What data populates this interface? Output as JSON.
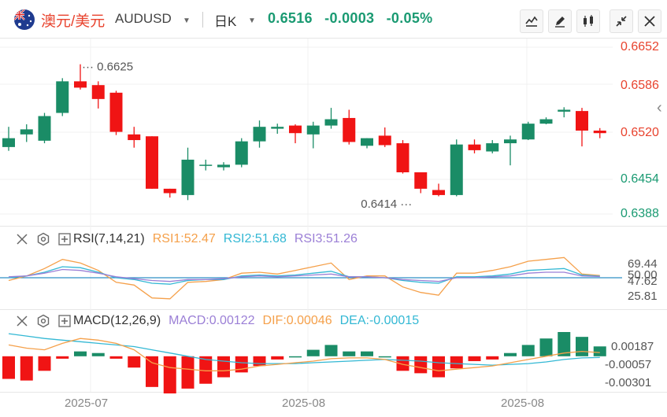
{
  "header": {
    "name": "澳元/美元",
    "code": "AUDUSD",
    "period": "日K",
    "price": "0.6516",
    "change": "-0.0003",
    "change_pct": "-0.05%"
  },
  "toolbar": {
    "icons": [
      "line-chart-icon",
      "draw-pencil-icon",
      "candle-type-icon",
      "collapse-icon",
      "close-icon"
    ]
  },
  "chart_data": [
    {
      "type": "candlestick",
      "title": "",
      "y_ticks": [
        "0.6652",
        "0.6586",
        "0.6520",
        "0.6454",
        "0.6388"
      ],
      "ylim": [
        0.6388,
        0.6652
      ],
      "x_ticks": [
        "2025-07",
        "2025-08",
        "2025-08"
      ],
      "annotations": [
        "0.6625",
        "0.6414"
      ],
      "candles": [
        {
          "o": 0.6494,
          "h": 0.6526,
          "l": 0.6488,
          "c": 0.6508
        },
        {
          "o": 0.6514,
          "h": 0.653,
          "l": 0.6502,
          "c": 0.6522
        },
        {
          "o": 0.6504,
          "h": 0.6548,
          "l": 0.65,
          "c": 0.6543
        },
        {
          "o": 0.6548,
          "h": 0.6603,
          "l": 0.6543,
          "c": 0.6598
        },
        {
          "o": 0.6598,
          "h": 0.6625,
          "l": 0.6585,
          "c": 0.6588
        },
        {
          "o": 0.6592,
          "h": 0.6598,
          "l": 0.6555,
          "c": 0.657
        },
        {
          "o": 0.658,
          "h": 0.6583,
          "l": 0.6513,
          "c": 0.6518
        },
        {
          "o": 0.6514,
          "h": 0.6526,
          "l": 0.6493,
          "c": 0.6505
        },
        {
          "o": 0.6511,
          "h": 0.6511,
          "l": 0.6428,
          "c": 0.6428
        },
        {
          "o": 0.6428,
          "h": 0.6428,
          "l": 0.6414,
          "c": 0.6421
        },
        {
          "o": 0.6418,
          "h": 0.6493,
          "l": 0.641,
          "c": 0.6474
        },
        {
          "o": 0.6466,
          "h": 0.6474,
          "l": 0.6457,
          "c": 0.6466
        },
        {
          "o": 0.6462,
          "h": 0.647,
          "l": 0.6457,
          "c": 0.6466
        },
        {
          "o": 0.6466,
          "h": 0.6508,
          "l": 0.6462,
          "c": 0.6503
        },
        {
          "o": 0.6503,
          "h": 0.6536,
          "l": 0.6493,
          "c": 0.6526
        },
        {
          "o": 0.6523,
          "h": 0.6531,
          "l": 0.6515,
          "c": 0.6526
        },
        {
          "o": 0.6528,
          "h": 0.653,
          "l": 0.65,
          "c": 0.6516
        },
        {
          "o": 0.6514,
          "h": 0.6534,
          "l": 0.6492,
          "c": 0.6528
        },
        {
          "o": 0.6528,
          "h": 0.6556,
          "l": 0.6523,
          "c": 0.6538
        },
        {
          "o": 0.654,
          "h": 0.6553,
          "l": 0.6498,
          "c": 0.6502
        },
        {
          "o": 0.6496,
          "h": 0.6508,
          "l": 0.6492,
          "c": 0.6508
        },
        {
          "o": 0.6512,
          "h": 0.6525,
          "l": 0.6494,
          "c": 0.6497
        },
        {
          "o": 0.65,
          "h": 0.6505,
          "l": 0.6452,
          "c": 0.6454
        },
        {
          "o": 0.6454,
          "h": 0.6454,
          "l": 0.6421,
          "c": 0.6428
        },
        {
          "o": 0.6426,
          "h": 0.6436,
          "l": 0.6416,
          "c": 0.6418
        },
        {
          "o": 0.6418,
          "h": 0.6506,
          "l": 0.6416,
          "c": 0.6498
        },
        {
          "o": 0.6498,
          "h": 0.6506,
          "l": 0.6484,
          "c": 0.6489
        },
        {
          "o": 0.6487,
          "h": 0.6505,
          "l": 0.6484,
          "c": 0.65
        },
        {
          "o": 0.65,
          "h": 0.6512,
          "l": 0.6465,
          "c": 0.6506
        },
        {
          "o": 0.6506,
          "h": 0.6534,
          "l": 0.6505,
          "c": 0.6531
        },
        {
          "o": 0.6531,
          "h": 0.6541,
          "l": 0.653,
          "c": 0.6538
        },
        {
          "o": 0.655,
          "h": 0.6557,
          "l": 0.6541,
          "c": 0.6553
        },
        {
          "o": 0.6551,
          "h": 0.6556,
          "l": 0.6495,
          "c": 0.652
        },
        {
          "o": 0.652,
          "h": 0.6524,
          "l": 0.6508,
          "c": 0.6516
        }
      ]
    },
    {
      "type": "line",
      "name": "RSI",
      "params": "RSI(7,14,21)",
      "legend": [
        {
          "label": "RSI1:52.47",
          "color": "#f5a04a"
        },
        {
          "label": "RSI2:51.68",
          "color": "#33b8d4"
        },
        {
          "label": "RSI3:51.26",
          "color": "#9b7fd6"
        }
      ],
      "y_ticks": [
        "69.44",
        "50.00",
        "47.62",
        "25.81"
      ],
      "ylim": [
        20,
        80
      ],
      "series": [
        {
          "name": "RSI1",
          "color": "#f5a04a",
          "values": [
            47,
            52,
            60,
            70,
            66,
            58,
            45,
            42,
            28,
            27,
            45,
            46,
            48,
            55,
            56,
            54,
            58,
            62,
            66,
            48,
            52,
            52,
            40,
            34,
            31,
            55,
            55,
            58,
            62,
            68,
            70,
            72,
            54,
            52.47
          ]
        },
        {
          "name": "RSI2",
          "color": "#33b8d4",
          "values": [
            50,
            52,
            56,
            62,
            61,
            56,
            50,
            48,
            44,
            43,
            47,
            48,
            48,
            52,
            53,
            52,
            53,
            55,
            57,
            51,
            51,
            50,
            47,
            45,
            44,
            51,
            51,
            52,
            54,
            58,
            59,
            60,
            53,
            51.68
          ]
        },
        {
          "name": "RSI3",
          "color": "#9b7fd6",
          "values": [
            51,
            52,
            55,
            59,
            58,
            55,
            51,
            49,
            47,
            46,
            48,
            48,
            49,
            51,
            52,
            51,
            52,
            53,
            54,
            51,
            51,
            50,
            48,
            47,
            46,
            50,
            50,
            51,
            52,
            55,
            56,
            56,
            52,
            51.26
          ]
        }
      ]
    },
    {
      "type": "bar+line",
      "name": "MACD",
      "params": "MACD(12,26,9)",
      "legend": [
        {
          "label": "MACD:0.00122",
          "color": "#9b7fd6"
        },
        {
          "label": "DIF:0.00046",
          "color": "#f5a04a"
        },
        {
          "label": "DEA:-0.00015",
          "color": "#33b8d4"
        }
      ],
      "y_ticks": [
        "0.00187",
        "-0.00057",
        "-0.00301"
      ],
      "ylim": [
        -0.0044,
        0.003
      ],
      "macd": [
        -0.0028,
        -0.003,
        -0.0018,
        -0.0003,
        0.0006,
        0.0004,
        -0.0003,
        -0.0014,
        -0.0038,
        -0.0046,
        -0.004,
        -0.0034,
        -0.0026,
        -0.002,
        -0.0012,
        -0.0004,
        0.0,
        0.0008,
        0.0014,
        0.0006,
        0.0006,
        0.0,
        -0.0018,
        -0.0021,
        -0.0026,
        -0.0015,
        -0.0006,
        -0.0004,
        0.0004,
        0.0014,
        0.0022,
        0.003,
        0.0024,
        0.00122
      ],
      "dif": [
        0.0014,
        0.001,
        0.0008,
        0.0016,
        0.0022,
        0.002,
        0.0016,
        0.0008,
        -0.0008,
        -0.0014,
        -0.0016,
        -0.0018,
        -0.0018,
        -0.0016,
        -0.0012,
        -0.001,
        -0.0008,
        -0.0006,
        -0.0003,
        -0.0002,
        -0.0002,
        -0.0004,
        -0.001,
        -0.0014,
        -0.0018,
        -0.0016,
        -0.0014,
        -0.0012,
        -0.0008,
        -0.0004,
        0.0,
        0.0004,
        0.0006,
        0.00046
      ],
      "dea": [
        0.0028,
        0.0025,
        0.0022,
        0.002,
        0.0018,
        0.0016,
        0.0014,
        0.0012,
        0.0008,
        0.0004,
        0.0,
        -0.0004,
        -0.0006,
        -0.0008,
        -0.0009,
        -0.0009,
        -0.0009,
        -0.0008,
        -0.0007,
        -0.0006,
        -0.0005,
        -0.0004,
        -0.0005,
        -0.0006,
        -0.0008,
        -0.0009,
        -0.001,
        -0.0011,
        -0.001,
        -0.0009,
        -0.0007,
        -0.0004,
        -0.0002,
        -0.00015
      ]
    }
  ]
}
